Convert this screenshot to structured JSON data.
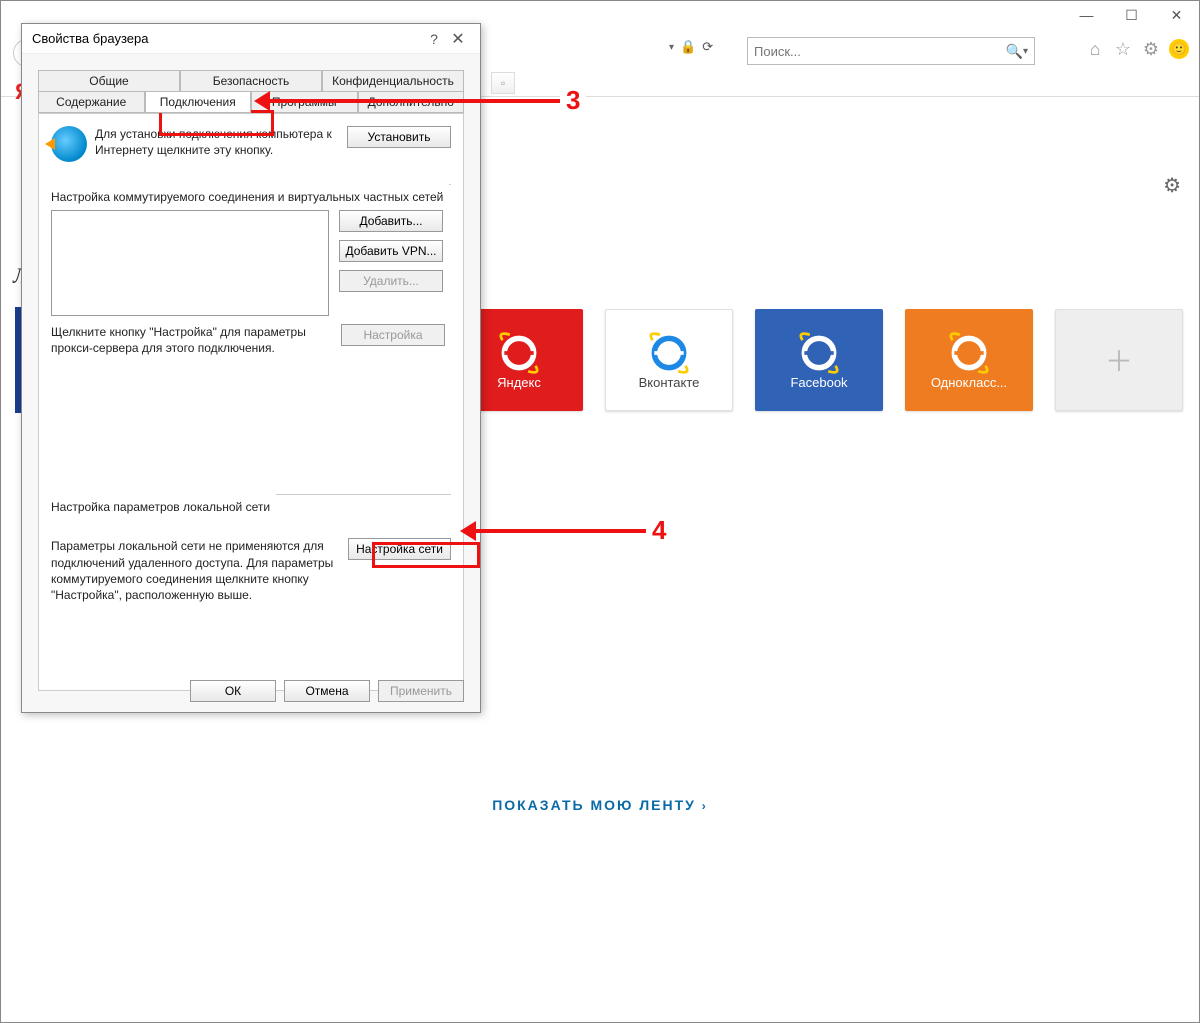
{
  "window": {
    "minimize": "—",
    "maximize": "☐",
    "close": "✕"
  },
  "toolbar": {
    "search_placeholder": "Поиск...",
    "dropdown": "▾"
  },
  "tiles": [
    {
      "label": "Яндекс",
      "cls": "tile-red"
    },
    {
      "label": "Вконтакте",
      "cls": "tile-white"
    },
    {
      "label": "Facebook",
      "cls": "tile-blue"
    },
    {
      "label": "Однокласс...",
      "cls": "tile-orange"
    }
  ],
  "feed_link": "ПОКАЗАТЬ МОЮ ЛЕНТУ",
  "annotations": {
    "step3": "3",
    "step4": "4"
  },
  "dialog": {
    "title": "Свойства браузера",
    "help": "?",
    "close": "✕",
    "tabs_row1": [
      "Общие",
      "Безопасность",
      "Конфиденциальность"
    ],
    "tabs_row2": [
      "Содержание",
      "Подключения",
      "Программы",
      "Дополнительно"
    ],
    "install_text": "Для установки подключения компьютера к Интернету щелкните эту кнопку.",
    "install_btn": "Установить",
    "dialup_title": "Настройка коммутируемого соединения и виртуальных частных сетей",
    "add_btn": "Добавить...",
    "add_vpn_btn": "Добавить VPN...",
    "delete_btn": "Удалить...",
    "settings_btn": "Настройка",
    "proxy_hint": "Щелкните кнопку \"Настройка\" для параметры прокси-сервера для этого подключения.",
    "lan_title": "Настройка параметров локальной сети",
    "lan_text": "Параметры локальной сети не применяются для подключений удаленного доступа. Для параметры коммутируемого соединения щелкните кнопку \"Настройка\", расположенную выше.",
    "lan_btn": "Настройка сети",
    "ok": "ОК",
    "cancel": "Отмена",
    "apply": "Применить"
  }
}
